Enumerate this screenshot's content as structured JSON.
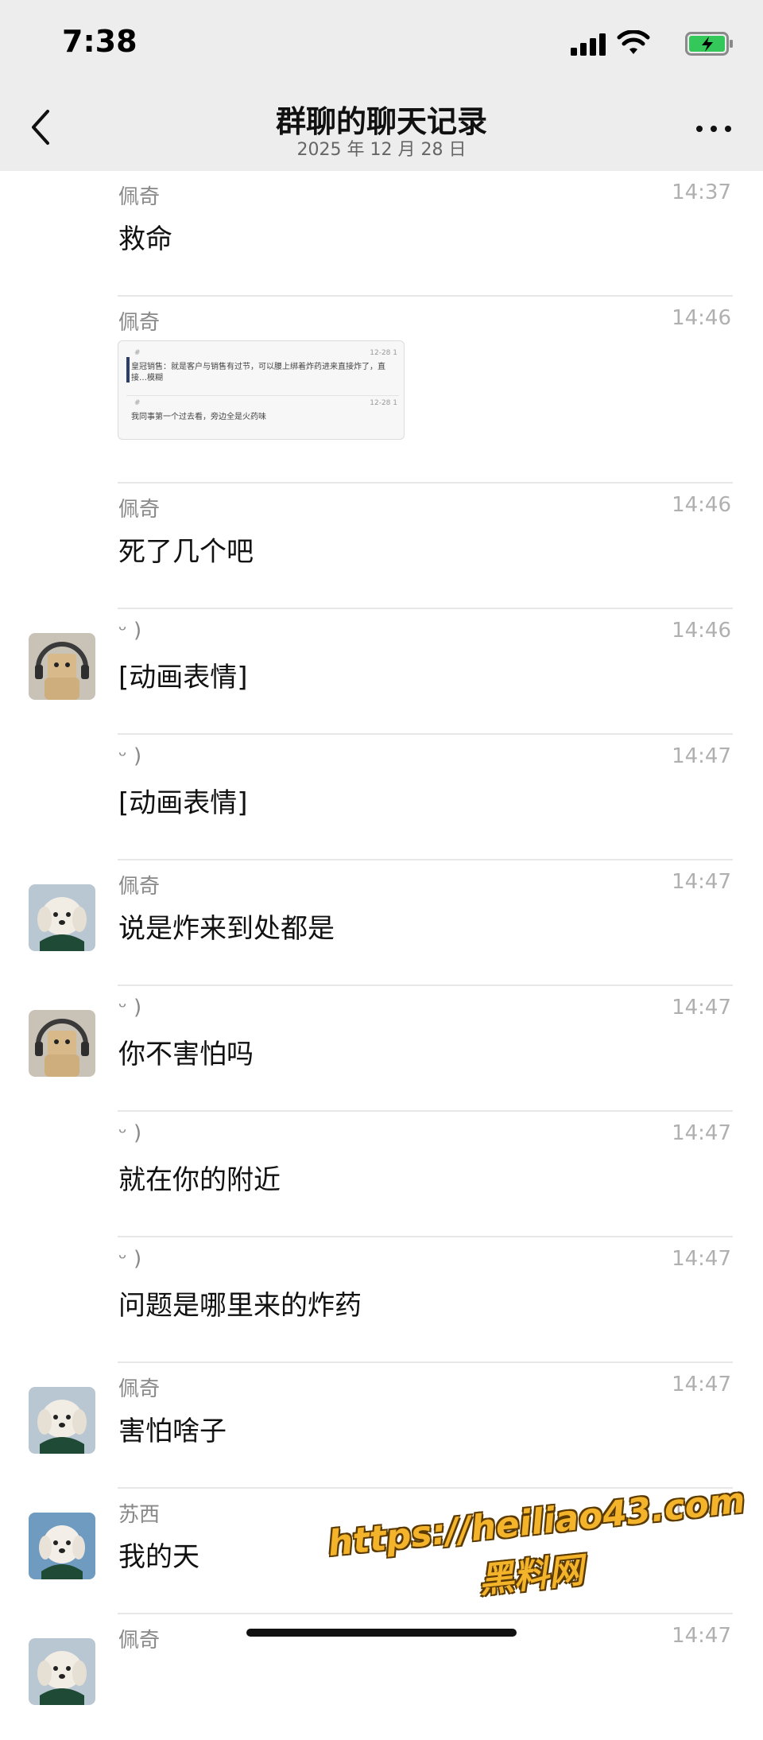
{
  "status_bar": {
    "time": "7:38"
  },
  "nav": {
    "title": "群聊的聊天记录",
    "subtitle": "2025 年 12 月 28 日"
  },
  "messages": [
    {
      "sender": "佩奇",
      "time": "14:37",
      "text": "救命",
      "avatar": ""
    },
    {
      "sender": "佩奇",
      "time": "14:46",
      "type": "image",
      "avatar": "",
      "thumb": {
        "hash1": "#",
        "date1": "12-28 1",
        "text1": "皇冠销售：就是客户与销售有过节，可以腰上绑着炸药进来直接炸了，直接…模糊",
        "hash2": "#",
        "date2": "12-28 1",
        "text2": "我同事第一个过去看，旁边全是火药味"
      }
    },
    {
      "sender": "佩奇",
      "time": "14:46",
      "text": "死了几个吧",
      "avatar": ""
    },
    {
      "sender": "ᵕ )",
      "time": "14:46",
      "text": "[动画表情]",
      "avatar": "bear"
    },
    {
      "sender": "ᵕ )",
      "time": "14:47",
      "text": "[动画表情]",
      "avatar": ""
    },
    {
      "sender": "佩奇",
      "time": "14:47",
      "text": "说是炸来到处都是",
      "avatar": "dog"
    },
    {
      "sender": "ᵕ )",
      "time": "14:47",
      "text": "你不害怕吗",
      "avatar": "bear"
    },
    {
      "sender": "ᵕ )",
      "time": "14:47",
      "text": "就在你的附近",
      "avatar": ""
    },
    {
      "sender": "ᵕ )",
      "time": "14:47",
      "text": "问题是哪里来的炸药",
      "avatar": ""
    },
    {
      "sender": "佩奇",
      "time": "14:47",
      "text": "害怕啥子",
      "avatar": "dog"
    },
    {
      "sender": "苏西",
      "time": "14:47",
      "text": "我的天",
      "avatar": "dog2"
    },
    {
      "sender": "佩奇",
      "time": "14:47",
      "text": "",
      "avatar": "dog"
    }
  ],
  "watermark": {
    "url": "https://heiliao43.com",
    "name": "黑料网"
  },
  "colors": {
    "header_bg": "#ededed",
    "divider": "#e7e7e7",
    "watermark": "#f3b32a"
  }
}
